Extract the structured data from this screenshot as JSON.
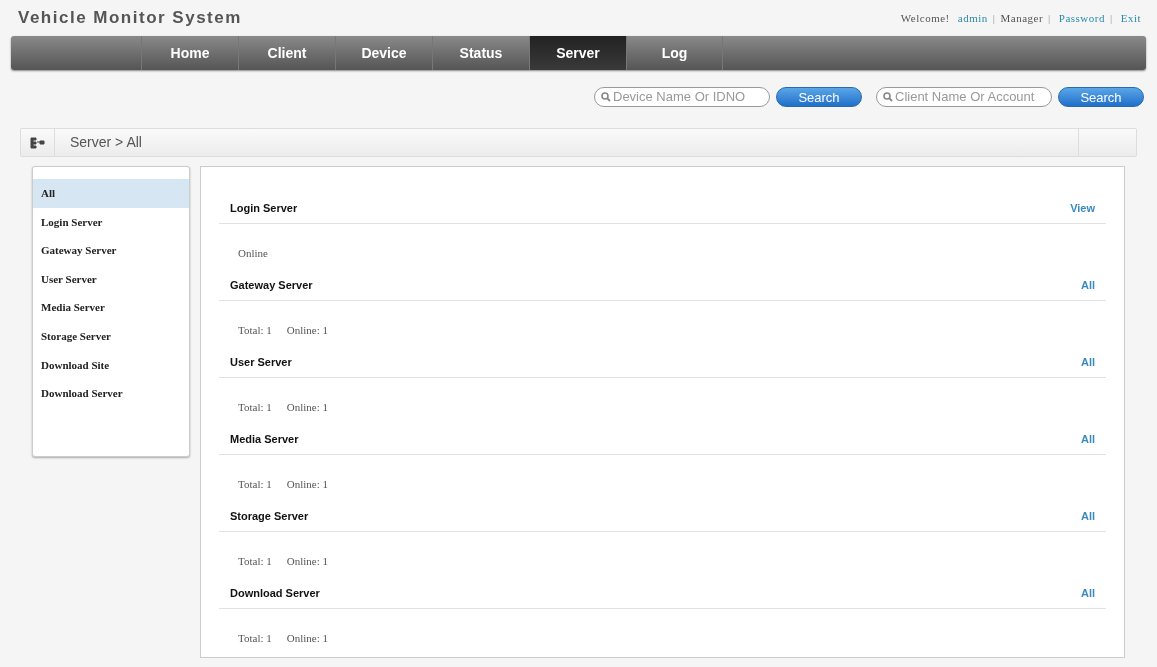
{
  "app_title": "Vehicle Monitor System",
  "user_bar": [
    {
      "text": "Welcome!",
      "kind": "text"
    },
    {
      "text": "admin",
      "kind": "link"
    },
    {
      "text": "|",
      "kind": "separator"
    },
    {
      "text": "Manager",
      "kind": "text"
    },
    {
      "text": "|",
      "kind": "separator"
    },
    {
      "text": "Password",
      "kind": "link"
    },
    {
      "text": "|",
      "kind": "separator"
    },
    {
      "text": "Exit",
      "kind": "link"
    }
  ],
  "nav_tabs": [
    {
      "label": "Home",
      "selected": false
    },
    {
      "label": "Client",
      "selected": false
    },
    {
      "label": "Device",
      "selected": false
    },
    {
      "label": "Status",
      "selected": false
    },
    {
      "label": "Server",
      "selected": true
    },
    {
      "label": "Log",
      "selected": false
    }
  ],
  "searches": [
    {
      "placeholder": "Device Name Or IDNO",
      "button": "Search"
    },
    {
      "placeholder": "Client Name Or Account",
      "button": "Search"
    }
  ],
  "breadcrumb": "Server > All",
  "sidebar_items": [
    {
      "label": "All",
      "selected": true
    },
    {
      "label": "Login Server",
      "selected": false
    },
    {
      "label": "Gateway Server",
      "selected": false
    },
    {
      "label": "User Server",
      "selected": false
    },
    {
      "label": "Media Server",
      "selected": false
    },
    {
      "label": "Storage Server",
      "selected": false
    },
    {
      "label": "Download Site",
      "selected": false
    },
    {
      "label": "Download Server",
      "selected": false
    }
  ],
  "sections": [
    {
      "title": "Login Server",
      "link": "View",
      "stats": [
        "Online"
      ]
    },
    {
      "title": "Gateway Server",
      "link": "All",
      "stats": [
        "Total: 1",
        "Online: 1"
      ]
    },
    {
      "title": "User Server",
      "link": "All",
      "stats": [
        "Total: 1",
        "Online: 1"
      ]
    },
    {
      "title": "Media Server",
      "link": "All",
      "stats": [
        "Total: 1",
        "Online: 1"
      ]
    },
    {
      "title": "Storage Server",
      "link": "All",
      "stats": [
        "Total: 1",
        "Online: 1"
      ]
    },
    {
      "title": "Download Server",
      "link": "All",
      "stats": [
        "Total: 1",
        "Online: 1"
      ]
    }
  ]
}
